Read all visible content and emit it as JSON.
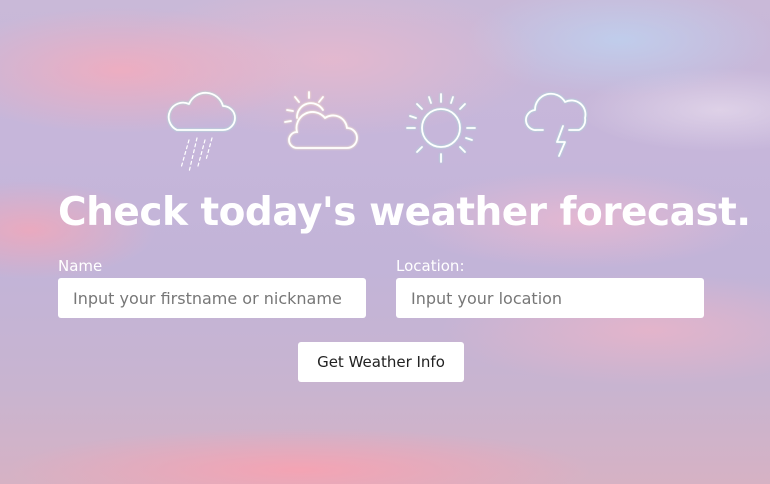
{
  "header": {
    "icons": [
      "rain-cloud-icon",
      "partly-cloudy-icon",
      "sun-icon",
      "thunderstorm-icon"
    ],
    "title": "Check today's weather forecast."
  },
  "form": {
    "name_label": "Name",
    "name_placeholder": "Input your firstname or nickname",
    "name_value": "",
    "location_label": "Location:",
    "location_placeholder": "Input your location",
    "location_value": "",
    "submit_label": "Get Weather Info"
  },
  "colors": {
    "text": "#ffffff",
    "icon_glow": "#a8f0dc",
    "sky_pink": "#f7b2c0",
    "sky_lavender": "#c4b6da"
  }
}
